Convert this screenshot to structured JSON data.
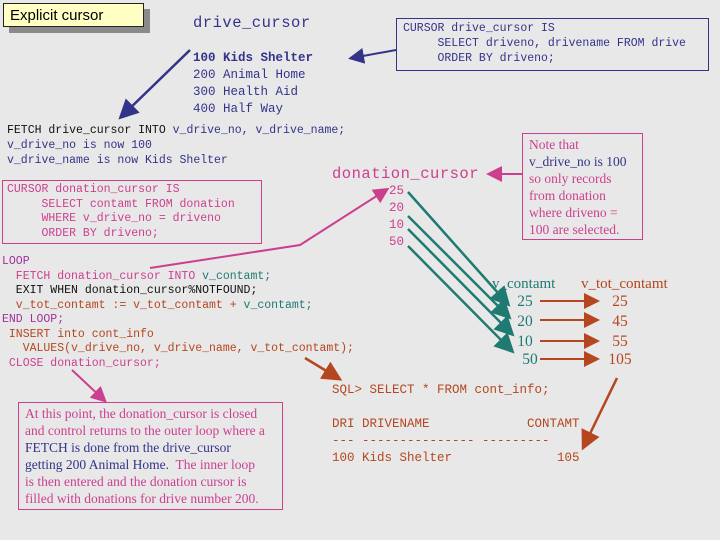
{
  "title": "Explicit cursor",
  "drive_cursor": {
    "label": "drive_cursor",
    "definition": [
      "CURSOR drive_cursor IS",
      "     SELECT driveno, drivename FROM drive",
      "     ORDER BY driveno;"
    ],
    "rows": [
      {
        "no": "100",
        "name": "Kids Shelter",
        "current": true
      },
      {
        "no": "200",
        "name": "Animal Home",
        "current": false
      },
      {
        "no": "300",
        "name": "Health Aid",
        "current": false
      },
      {
        "no": "400",
        "name": "Half Way",
        "current": false
      }
    ]
  },
  "fetch": {
    "statement_keyword": "FETCH drive_cursor INTO ",
    "statement_vars": "v_drive_no, v_drive_name;",
    "line2": "v_drive_no is now 100",
    "line3": "v_drive_name is now Kids Shelter"
  },
  "donation_cursor": {
    "label": "donation_cursor",
    "definition": [
      "CURSOR donation_cursor IS",
      "     SELECT contamt FROM donation",
      "     WHERE v_drive_no = driveno",
      "     ORDER BY driveno;"
    ],
    "values": [
      "25",
      "20",
      "10",
      "50"
    ]
  },
  "note_top": {
    "line1": "Note that",
    "line2": "v_drive_no is 100",
    "line3": "so only records",
    "line4": "from donation",
    "line5": "where driveno =",
    "line6": "100 are selected."
  },
  "loop": {
    "l1": "LOOP",
    "l2a": "  FETCH donation_cursor INTO ",
    "l2b": "v_contamt;",
    "l3": "  EXIT WHEN donation_cursor%NOTFOUND;",
    "l4a": "  v_tot_contamt := v_tot_contamt + ",
    "l4b": "v_contamt;",
    "l5": "END LOOP;",
    "l6": " INSERT into cont_info",
    "l7": "   VALUES(v_drive_no, v_drive_name, v_tot_contamt);",
    "l8": " CLOSE donation_cursor;"
  },
  "accumulation": {
    "contamt_header": "v_contamt",
    "tot_header": "v_tot_contamt",
    "contamt": [
      "25",
      "20",
      "10",
      "50"
    ],
    "totals": [
      "25",
      "45",
      "55",
      "105"
    ]
  },
  "bottom_note": {
    "line1": "At this point, the donation_cursor is closed",
    "line2": "and control returns to the outer loop where a",
    "line3": "FETCH is done from the drive_cursor",
    "line4a": "getting 200 Animal Home.  ",
    "line4b": "The inner loop",
    "line5": "is then entered and the donation cursor is",
    "line6": "filled with donations for drive number 200."
  },
  "sql": {
    "query": "SQL> SELECT * FROM cont_info;",
    "header": "DRI DRIVENAME             CONTAMT",
    "separator": "--- --------------- ---------",
    "row": "100 Kids Shelter              105"
  },
  "colors": {
    "navy": "#33338a",
    "pink": "#cc3f8f",
    "teal": "#1f7a72",
    "rust": "#b5461f",
    "title_bg": "#ffffc4",
    "background": "#e8e8e8"
  }
}
